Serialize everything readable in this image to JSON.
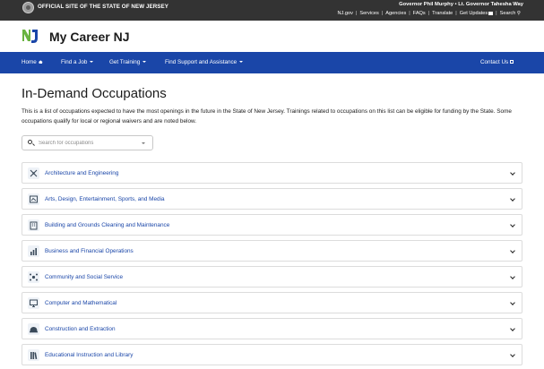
{
  "statebar": {
    "official": "OFFICIAL SITE OF THE STATE OF NEW JERSEY",
    "governor": "Governor Phil Murphy • Lt. Governor Tahesha Way",
    "links": [
      "NJ.gov",
      "Services",
      "Agencies",
      "FAQs",
      "Translate",
      "Get Updates",
      "Search"
    ]
  },
  "header": {
    "brand": "My Career NJ"
  },
  "nav": {
    "home": "Home",
    "find_job": "Find a Job",
    "get_training": "Get Training",
    "find_support": "Find Support and Assistance",
    "contact": "Contact Us"
  },
  "main": {
    "title": "In-Demand Occupations",
    "intro": "This is a list of occupations expected to have the most openings in the future in the State of New Jersey. Trainings related to occupations on this list can be eligible for funding by the State. Some occupations qualify for local or regional waivers and are noted below.",
    "search_placeholder": "Search for occupations",
    "categories": [
      {
        "label": "Architecture and Engineering",
        "icon": "compass-ruler-icon"
      },
      {
        "label": "Arts, Design, Entertainment, Sports, and Media",
        "icon": "palette-icon"
      },
      {
        "label": "Building and Grounds Cleaning and Maintenance",
        "icon": "building-icon"
      },
      {
        "label": "Business and Financial Operations",
        "icon": "bar-chart-icon"
      },
      {
        "label": "Community and Social Service",
        "icon": "community-icon"
      },
      {
        "label": "Computer and Mathematical",
        "icon": "computer-icon"
      },
      {
        "label": "Construction and Extraction",
        "icon": "hard-hat-icon"
      },
      {
        "label": "Educational Instruction and Library",
        "icon": "books-icon"
      }
    ]
  },
  "colors": {
    "nav_blue": "#1a46a8",
    "statebar": "#333333",
    "link_blue": "#1a46a8"
  }
}
